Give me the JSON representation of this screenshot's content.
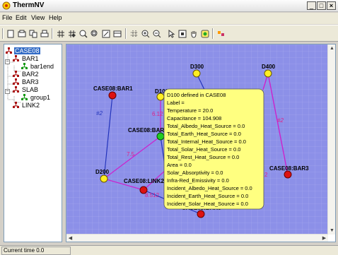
{
  "window": {
    "title": "ThermNV",
    "min_glyph": "_",
    "max_glyph": "□",
    "close_glyph": "×"
  },
  "menu": [
    "File",
    "Edit",
    "View",
    "Help"
  ],
  "toolbar_icons": [
    "new-icon",
    "open-icon",
    "copy-icon",
    "print-icon",
    "grid-icon",
    "grid-snap-icon",
    "zoom-fit-icon",
    "zoom-window-icon",
    "properties-icon",
    "table-icon",
    "select-all-icon",
    "zoom-in-icon",
    "zoom-out-icon",
    "pointer-icon",
    "pan-box-icon",
    "hand-icon",
    "tooltip-icon",
    "color-icon"
  ],
  "tree": [
    {
      "label": "CASE08",
      "selected": true,
      "icon": "case-icon"
    },
    {
      "label": "BAR1",
      "icon": "case-icon"
    },
    {
      "label": "bar1end",
      "icon": "node-icon"
    },
    {
      "label": "BAR2",
      "icon": "case-icon"
    },
    {
      "label": "BAR3",
      "icon": "case-icon"
    },
    {
      "label": "SLAB",
      "icon": "case-icon"
    },
    {
      "label": "group1",
      "icon": "node-icon"
    },
    {
      "label": "LINK2",
      "icon": "case-icon"
    }
  ],
  "tree_expanders": [
    "−",
    "−",
    "−"
  ],
  "colors": {
    "canvas_bg": "#8c90e8",
    "grid": "#a9acf0",
    "conductor": "#2233bb",
    "radiation": "#cc22cc",
    "node_red": "#dd1111",
    "node_yellow": "#ffee22",
    "node_green": "#22cc22",
    "tooltip_bg": "#ffff80",
    "edge_label": "#dd2288"
  },
  "canvas": {
    "node_labels": [
      "CASE08:BAR1",
      "D100",
      "D300",
      "D400",
      "CASE08:BAR2",
      "D200",
      "CASE08:LINK2",
      "CASE08:BAR3",
      "CASE08:BAR5"
    ],
    "edge_labels": [
      "#2",
      "6.12",
      "7.5",
      "8.512",
      "#2",
      "2"
    ]
  },
  "tooltip": {
    "lines": [
      "D100 defined in CASE08",
      "Label =",
      "Temperature = 20.0",
      "Capacitance = 104.908",
      "Total_Albedo_Heat_Source = 0.0",
      "Total_Earth_Heat_Source = 0.0",
      "Total_Internal_Heat_Source = 0.0",
      "Total_Solar_Heat_Source = 0.0",
      "Total_Rest_Heat_Source = 0.0",
      "Area = 0.0",
      "Solar_Absorptivity = 0.0",
      "Infra-Red_Emissivity = 0.0",
      "Incident_Albedo_Heat_Source = 0.0",
      "Incident_Earth_Heat_Source = 0.0",
      "Incident_Solar_Heat_Source = 0.0"
    ]
  },
  "status": {
    "text": "Current time 0.0"
  },
  "scroll": {
    "up": "▲",
    "down": "▼",
    "left": "◀",
    "right": "▶"
  }
}
